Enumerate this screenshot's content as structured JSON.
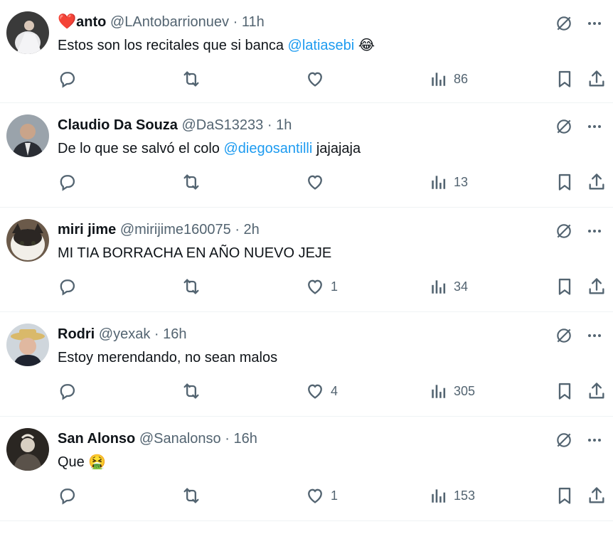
{
  "colors": {
    "text": "#0f1419",
    "muted": "#536471",
    "mention": "#1d9bf0",
    "divider": "#eff3f4",
    "heart": "#d81e3f"
  },
  "icons": {
    "reply": "reply-icon",
    "retweet": "retweet-icon",
    "like": "heart-icon",
    "views": "views-chart-icon",
    "bookmark": "bookmark-icon",
    "share": "share-icon",
    "grok": "grok-icon",
    "more": "more-icon"
  },
  "tweets": [
    {
      "name_prefix": "❤️",
      "name": "anto",
      "handle": "@LAntobarrionuev",
      "dot": "·",
      "time": "11h",
      "text_before": "Estos son los recitales que si banca ",
      "mention": "@latiasebi",
      "text_after": " ",
      "emoji": "😂",
      "likes": "",
      "views": "86"
    },
    {
      "name": "Claudio Da Souza",
      "handle": "@DaS13233",
      "dot": "·",
      "time": "1h",
      "text_before": "De lo que se salvó el colo ",
      "mention": "@diegosantilli",
      "text_after": " jajajaja",
      "emoji": "",
      "likes": "",
      "views": "13"
    },
    {
      "name": "miri jime",
      "handle": "@mirijime160075",
      "dot": "·",
      "time": "2h",
      "text_before": "MI TIA BORRACHA EN AÑO NUEVO JEJE",
      "mention": "",
      "text_after": "",
      "emoji": "",
      "likes": "1",
      "views": "34"
    },
    {
      "name": "Rodri",
      "handle": "@yexak",
      "dot": "·",
      "time": "16h",
      "text_before": "Estoy merendando, no sean malos",
      "mention": "",
      "text_after": "",
      "emoji": "",
      "likes": "4",
      "views": "305"
    },
    {
      "name": "San Alonso",
      "handle": "@Sanalonso",
      "dot": "·",
      "time": "16h",
      "text_before": "Que ",
      "mention": "",
      "text_after": "",
      "emoji": "🤮",
      "likes": "1",
      "views": "153"
    }
  ]
}
